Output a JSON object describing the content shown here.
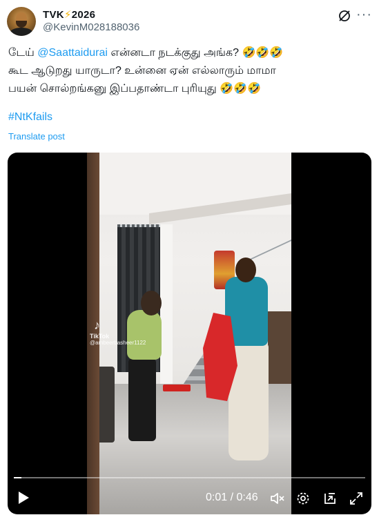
{
  "author": {
    "display_name": "TVK",
    "name_emoji": "⚡",
    "name_suffix": "2026",
    "handle": "@KevinM028188036",
    "avatar_icon": "user-avatar"
  },
  "header_icons": {
    "grok": "grok-icon",
    "more": "more-options-icon"
  },
  "tweet": {
    "line1_prefix": "டேய் ",
    "mention": "@Saattaidurai",
    "line1_suffix": " என்னடா நடக்குது அங்க? 🤣🤣🤣",
    "line2": "கூட ஆடுறது யாருடா? உன்னை ஏன் எல்லாரும் மாமா",
    "line3": "பயன் சொல்றங்கனு இப்பதாண்டா புரியுது 🤣🤣🤣",
    "hashtag": "#NtKfails",
    "translate_label": "Translate post"
  },
  "video": {
    "watermark_logo": "♪",
    "watermark_label": "TikTok",
    "watermark_user": "@ambeerbasheer1122",
    "time_display": "0:01 / 0:46",
    "progress": 0.022,
    "controls": {
      "play": "play-icon",
      "mute": "mute-icon",
      "settings": "settings-icon",
      "pip": "picture-in-picture-icon",
      "fullscreen": "fullscreen-icon"
    }
  },
  "colors": {
    "accent": "#1d9bf0",
    "text": "#0f1419",
    "muted": "#536471",
    "bolt": "#f5b50a"
  }
}
